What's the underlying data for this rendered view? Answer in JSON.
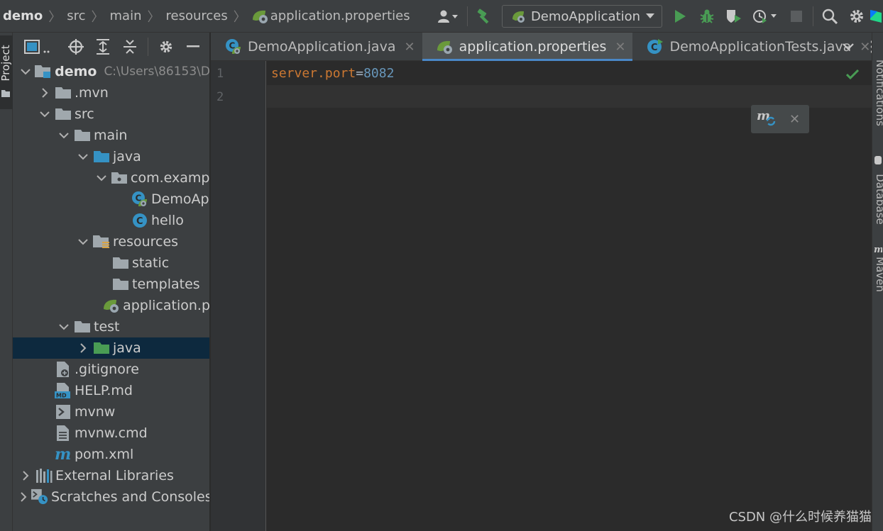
{
  "breadcrumbs": [
    {
      "label": "demo"
    },
    {
      "label": "src"
    },
    {
      "label": "main"
    },
    {
      "label": "resources"
    },
    {
      "label": "application.properties",
      "icon": "spring-properties-icon"
    }
  ],
  "run_config": {
    "label": "DemoApplication"
  },
  "toolbar_icons": [
    "user-icon",
    "chevron-down-icon",
    "build-hammer-icon",
    "run-icon",
    "debug-icon",
    "coverage-icon",
    "profile-icon",
    "stop-icon",
    "search-icon",
    "gear-icon"
  ],
  "left_strip": {
    "project_tab": "Project"
  },
  "project_tree": [
    {
      "name": "demo",
      "path": "C:\\Users\\86153\\D",
      "depth": 0,
      "expanded": true,
      "icon": "module-folder-icon",
      "bold": true
    },
    {
      "name": ".mvn",
      "depth": 1,
      "expanded": false,
      "icon": "folder-icon"
    },
    {
      "name": "src",
      "depth": 1,
      "expanded": true,
      "icon": "folder-icon"
    },
    {
      "name": "main",
      "depth": 2,
      "expanded": true,
      "icon": "folder-icon"
    },
    {
      "name": "java",
      "depth": 3,
      "expanded": true,
      "icon": "source-folder-icon"
    },
    {
      "name": "com.exampl",
      "depth": 4,
      "expanded": true,
      "icon": "package-icon"
    },
    {
      "name": "DemoAp",
      "depth": 5,
      "icon": "spring-class-icon"
    },
    {
      "name": "hello",
      "depth": 5,
      "icon": "class-icon"
    },
    {
      "name": "resources",
      "depth": 3,
      "expanded": true,
      "icon": "resources-folder-icon"
    },
    {
      "name": "static",
      "depth": 4,
      "icon": "folder-icon"
    },
    {
      "name": "templates",
      "depth": 4,
      "icon": "folder-icon"
    },
    {
      "name": "application.p",
      "depth": 4,
      "icon": "spring-properties-icon"
    },
    {
      "name": "test",
      "depth": 2,
      "expanded": true,
      "icon": "folder-icon"
    },
    {
      "name": "java",
      "depth": 3,
      "expanded": false,
      "icon": "test-source-folder-icon",
      "selected": true
    },
    {
      "name": ".gitignore",
      "depth": 1,
      "icon": "gitignore-file-icon"
    },
    {
      "name": "HELP.md",
      "depth": 1,
      "icon": "markdown-file-icon"
    },
    {
      "name": "mvnw",
      "depth": 1,
      "icon": "shell-file-icon"
    },
    {
      "name": "mvnw.cmd",
      "depth": 1,
      "icon": "text-file-icon"
    },
    {
      "name": "pom.xml",
      "depth": 1,
      "icon": "maven-icon"
    },
    {
      "name": "External Libraries",
      "depth": 0,
      "expanded": false,
      "icon": "libraries-icon"
    },
    {
      "name": "Scratches and Consoles",
      "depth": 0,
      "expanded": false,
      "icon": "scratches-icon"
    }
  ],
  "tabs": [
    {
      "label": "DemoApplication.java",
      "icon": "spring-class-icon",
      "active": false
    },
    {
      "label": "application.properties",
      "icon": "spring-properties-icon",
      "active": true
    },
    {
      "label": "DemoApplicationTests.java",
      "icon": "test-class-icon",
      "active": false
    }
  ],
  "editor": {
    "line_numbers": [
      "1",
      "2"
    ],
    "code": {
      "key": "server.port",
      "eq": "=",
      "value": "8082"
    }
  },
  "right_strip": [
    "Notifications",
    "Database",
    "Maven"
  ],
  "watermark": "CSDN @什么时候养猫猫",
  "colors": {
    "accent": "#4a88c7",
    "selection": "#0d293e",
    "key": "#cc7832",
    "number": "#6897bb",
    "run_green": "#499c54"
  }
}
